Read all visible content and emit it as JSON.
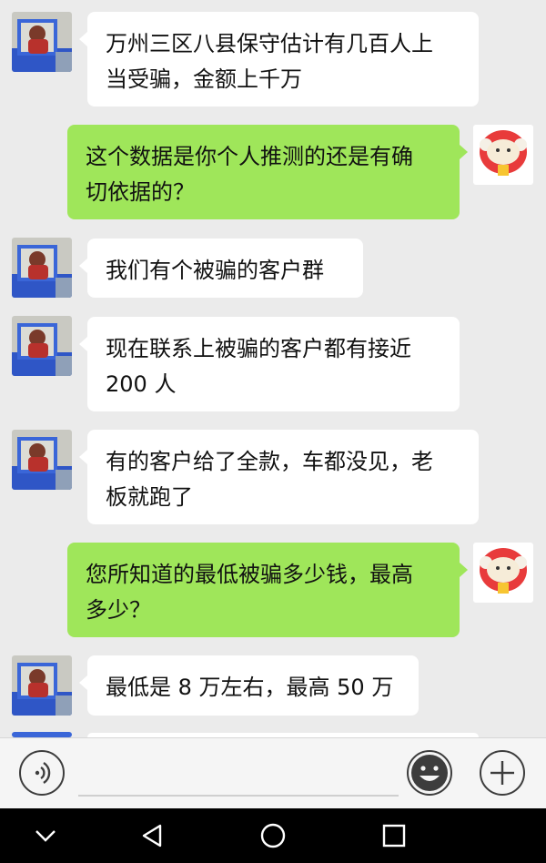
{
  "messages": [
    {
      "side": "left",
      "lines": [
        "万州三区八县保守估计有几百人上",
        "当受骗，金额上千万"
      ]
    },
    {
      "side": "right",
      "lines": [
        "这个数据是你个人推测的还是有确",
        "切依据的？"
      ]
    },
    {
      "side": "left",
      "lines": [
        "我们有个被骗的客户群"
      ]
    },
    {
      "side": "left",
      "lines": [
        "现在联系上被骗的客户都有接近",
        "200 人"
      ]
    },
    {
      "side": "left",
      "lines": [
        "有的客户给了全款，车都没见，老",
        "板就跑了"
      ]
    },
    {
      "side": "right",
      "lines": [
        "您所知道的最低被骗多少钱，最高",
        "多少？"
      ]
    },
    {
      "side": "left",
      "lines": [
        "最低是 8 万左右，最高 50 万"
      ]
    }
  ],
  "colors": {
    "background": "#ebebeb",
    "received_bubble": "#ffffff",
    "sent_bubble": "#9fe65a",
    "nav_bar": "#000000"
  },
  "icons": {
    "voice": "voice-icon",
    "emoji": "emoji-icon",
    "more": "plus-icon",
    "nav_collapse": "chevron-down-icon",
    "nav_back": "back-triangle-icon",
    "nav_home": "home-circle-icon",
    "nav_recents": "recents-square-icon"
  }
}
